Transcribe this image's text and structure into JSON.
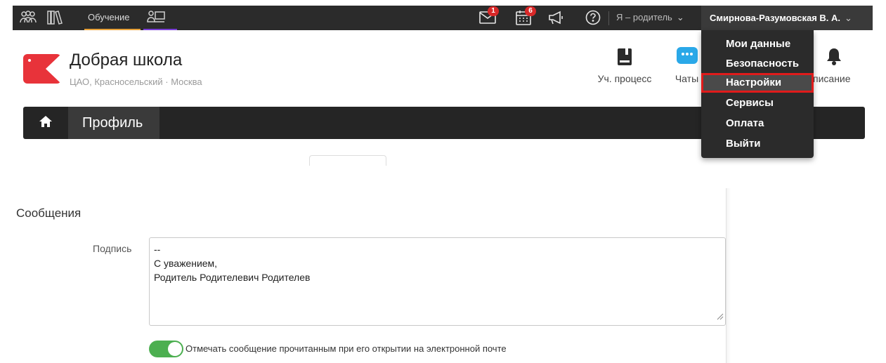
{
  "topbar": {
    "learning_label": "Обучение",
    "messages_badge": "1",
    "calendar_badge": "6",
    "role_label": "Я – родитель",
    "user_name": "Смирнова-Разумовская В. А."
  },
  "school": {
    "name": "Добрая школа",
    "location": "ЦАО, Красносельский · Москва"
  },
  "nav": {
    "process_label": "Уч. процесс",
    "chats_label": "Чаты",
    "schedule_label": "списание"
  },
  "profile": {
    "tab_label": "Профиль"
  },
  "user_menu": {
    "items": [
      "Мои данные",
      "Безопасность",
      "Настройки",
      "Сервисы",
      "Оплата",
      "Выйти"
    ],
    "active_item": "Настройки"
  },
  "messages": {
    "section_title": "Сообщения",
    "signature_label": "Подпись",
    "signature_value": "--\nС уважением,\nРодитель Родителевич Родителев",
    "mark_read_label": "Отмечать сообщение прочитанным при его открытии на электронной почте",
    "mark_read_enabled": true
  },
  "colors": {
    "topbar_bg": "#2b2b2b",
    "brand_red": "#e8333a",
    "toggle_on": "#4caf50",
    "highlight_border": "#e01b1b",
    "learning_underline": "#e8a23a",
    "classroom_underline": "#7a3fd6"
  }
}
